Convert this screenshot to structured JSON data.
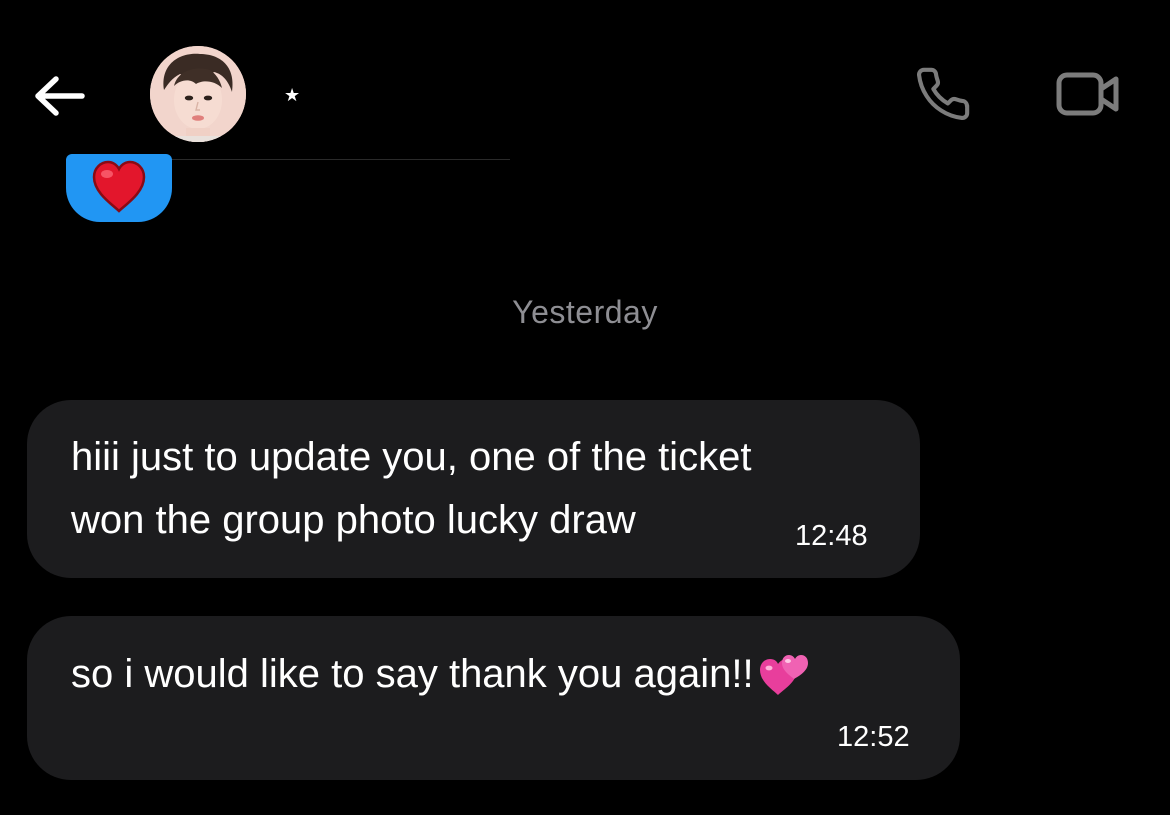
{
  "header": {
    "contact_name": "★",
    "back_icon": "arrow-left-icon",
    "call_icon": "phone-icon",
    "video_icon": "video-camera-icon"
  },
  "colors": {
    "background": "#000000",
    "bubble_incoming": "#1c1c1e",
    "bubble_outgoing": "#2196f3",
    "icon_gray": "#7c7c7c",
    "date_text": "#8e8e93"
  },
  "outgoing_reaction": {
    "emoji_icon": "red-heart-icon"
  },
  "date_separator": "Yesterday",
  "messages": [
    {
      "text": "hiii just to update you, one of the ticket\nwon the group photo lucky draw",
      "time": "12:48"
    },
    {
      "text": "so i would like to say thank you again!!",
      "emoji_icon": "two-hearts-icon",
      "time": "12:52"
    }
  ]
}
